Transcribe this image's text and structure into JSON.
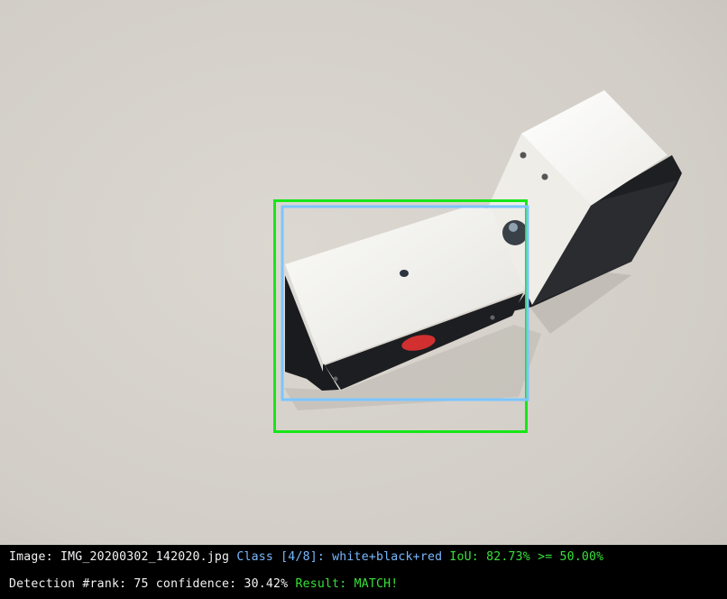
{
  "overlay": {
    "colors": {
      "ground_truth_box": "#17e617",
      "detection_box": "#7cc6ff",
      "text_default": "#f2f2f2",
      "text_class": "#78b8ff",
      "text_success": "#38e038",
      "bar_background": "#000000"
    }
  },
  "info": {
    "line1": {
      "image_label": "Image: IMG_20200302_142020.jpg",
      "class_label": "Class [4/8]: white+black+red",
      "iou_label": "IoU: 82.73% >= 50.00%"
    },
    "line2": {
      "detection_label": "Detection #rank: 75 confidence: 30.42%",
      "result_label": "Result: MATCH!"
    }
  }
}
